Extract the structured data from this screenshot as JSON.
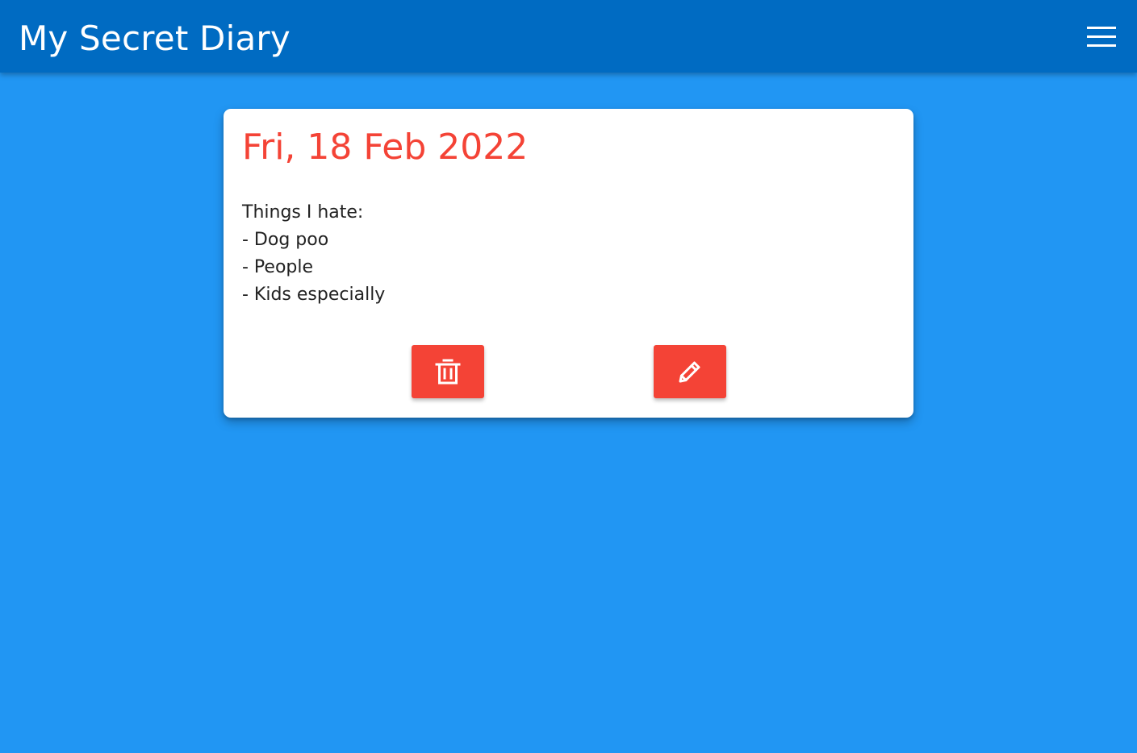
{
  "header": {
    "title": "My Secret Diary",
    "menu_icon": "hamburger-menu-icon"
  },
  "entry": {
    "date": "Fri, 18 Feb 2022",
    "lines": [
      "Things I hate:",
      "- Dog poo",
      "- People",
      "- Kids especially"
    ],
    "actions": {
      "delete_icon": "trash-icon",
      "edit_icon": "pencil-icon"
    }
  },
  "colors": {
    "page_background": "#2196f3",
    "header_background": "#006bc2",
    "accent": "#f44336",
    "card_background": "#ffffff",
    "body_text": "#222222"
  }
}
